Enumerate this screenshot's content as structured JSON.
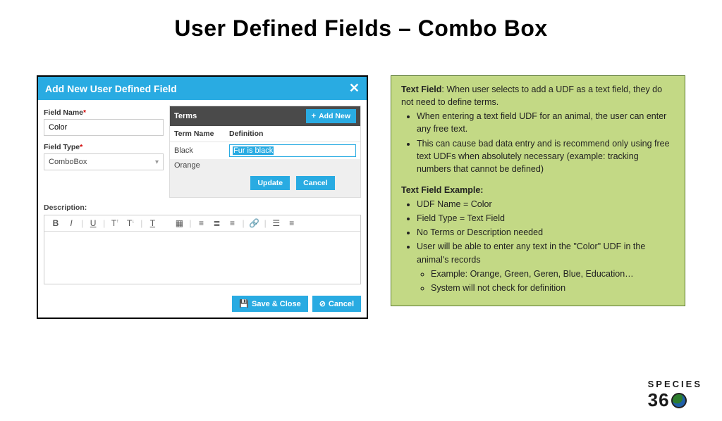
{
  "title": "User Defined Fields – Combo Box",
  "modal": {
    "header": "Add New User Defined Field",
    "fieldNameLabel": "Field Name",
    "fieldNameValue": "Color",
    "fieldTypeLabel": "Field Type",
    "fieldTypeValue": "ComboBox",
    "termsHeader": "Terms",
    "addNewLabel": "Add New",
    "col1": "Term Name",
    "col2": "Definition",
    "rows": [
      {
        "name": "Black",
        "def": "Fur is black",
        "editing": true
      },
      {
        "name": "Orange",
        "def": "",
        "editing": false
      }
    ],
    "updateLabel": "Update",
    "cancelLabel": "Cancel",
    "descriptionLabel": "Description:",
    "saveLabel": "Save & Close",
    "footerCancel": "Cancel"
  },
  "callout": {
    "leadBold": "Text Field",
    "leadRest": ":  When user selects to add a UDF as a text field, they do not need to define terms.",
    "bullets1": [
      "When entering a text field UDF for an animal, the user can enter any free text.",
      "This can cause bad data entry and is recommend only using free text UDFs when absolutely necessary (example: tracking numbers that cannot be defined)"
    ],
    "sec": "Text Field Example:",
    "bullets2": [
      "UDF Name = Color",
      "Field Type = Text Field",
      "No Terms or Description needed",
      "User will be able to enter any text in the \"Color\" UDF in the animal's records"
    ],
    "bullets2_nested": [
      "Example: Orange, Green, Geren, Blue, Education…",
      "System will not check for definition"
    ]
  },
  "logo": {
    "line1": "SPECIES",
    "line2a": "36",
    "line2b": "0"
  }
}
